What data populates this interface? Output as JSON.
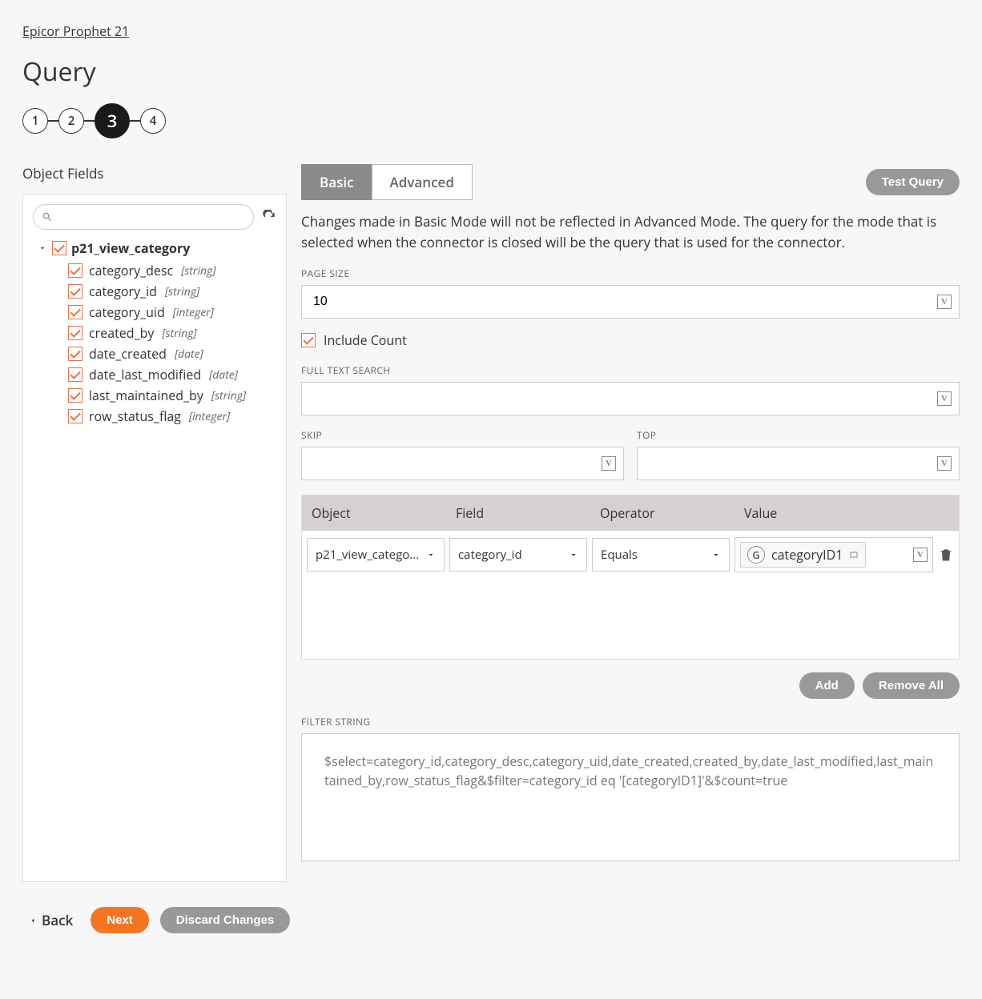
{
  "breadcrumb": "Epicor Prophet 21",
  "page_title": "Query",
  "stepper": {
    "steps": [
      "1",
      "2",
      "3",
      "4"
    ],
    "active_index": 2
  },
  "left": {
    "title": "Object Fields",
    "search_placeholder": "",
    "root": {
      "name": "p21_view_category",
      "checked": true
    },
    "fields": [
      {
        "name": "category_desc",
        "type": "string",
        "checked": true
      },
      {
        "name": "category_id",
        "type": "string",
        "checked": true
      },
      {
        "name": "category_uid",
        "type": "integer",
        "checked": true
      },
      {
        "name": "created_by",
        "type": "string",
        "checked": true
      },
      {
        "name": "date_created",
        "type": "date",
        "checked": true
      },
      {
        "name": "date_last_modified",
        "type": "date",
        "checked": true
      },
      {
        "name": "last_maintained_by",
        "type": "string",
        "checked": true
      },
      {
        "name": "row_status_flag",
        "type": "integer",
        "checked": true
      }
    ]
  },
  "tabs": {
    "basic": "Basic",
    "advanced": "Advanced",
    "test_query": "Test Query"
  },
  "info": "Changes made in Basic Mode will not be reflected in Advanced Mode. The query for the mode that is selected when the connector is closed will be the query that is used for the connector.",
  "labels": {
    "page_size": "PAGE SIZE",
    "include_count": "Include Count",
    "full_text": "FULL TEXT SEARCH",
    "skip": "SKIP",
    "top": "TOP",
    "filter_string": "FILTER STRING"
  },
  "page_size_value": "10",
  "include_count_checked": true,
  "full_text_value": "",
  "skip_value": "",
  "top_value": "",
  "filter_table": {
    "headers": {
      "object": "Object",
      "field": "Field",
      "operator": "Operator",
      "value": "Value"
    },
    "rows": [
      {
        "object": "p21_view_catego...",
        "field": "category_id",
        "operator": "Equals",
        "value_chip": "categoryID1"
      }
    ]
  },
  "buttons": {
    "add": "Add",
    "remove_all": "Remove All",
    "back": "Back",
    "next": "Next",
    "discard": "Discard Changes"
  },
  "filter_string": "$select=category_id,category_desc,category_uid,date_created,created_by,date_last_modified,last_maintained_by,row_status_flag&$filter=category_id eq '[categoryID1]'&$count=true"
}
